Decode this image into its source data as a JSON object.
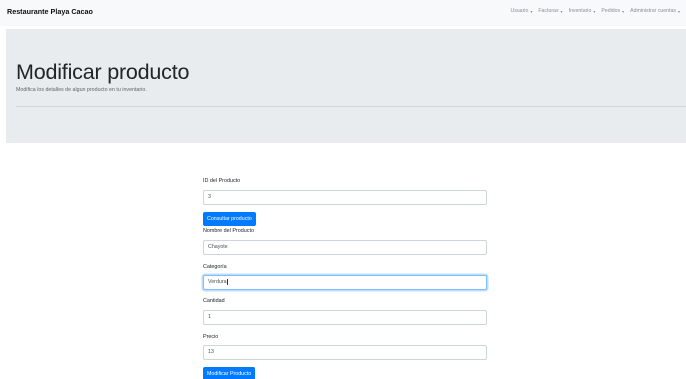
{
  "navbar": {
    "brand": "Restaurante Playa Cacao",
    "items": [
      {
        "label": "Usuario"
      },
      {
        "label": "Facturas"
      },
      {
        "label": "Inventario"
      },
      {
        "label": "Pedidos"
      },
      {
        "label": "Administrar cuentas"
      }
    ],
    "caret": "▾"
  },
  "header": {
    "title": "Modificar producto",
    "lead": "Modifica los detalles de algun producto en tu inventario."
  },
  "form": {
    "id_label": "ID del Producto",
    "id_value": "3",
    "consult_button": "Consultar producto",
    "name_label": "Nombre del Producto",
    "name_value": "Chayote",
    "category_label": "Categoría",
    "category_value": "Verdura",
    "quantity_label": "Cantidad",
    "quantity_value": "1",
    "price_label": "Precio",
    "price_value": "13",
    "submit_button": "Modificar Producto"
  },
  "colors": {
    "primary": "#007bff",
    "navbar_bg": "#f8f9fa",
    "jumbotron_bg": "#e9ecef"
  }
}
